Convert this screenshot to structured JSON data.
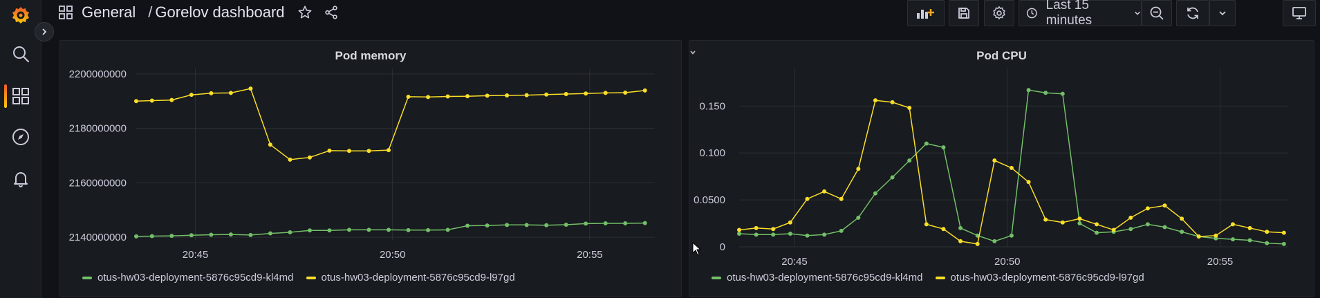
{
  "header": {
    "folder": "General",
    "dashboard": "Gorelov dashboard",
    "separator": "/",
    "time_range": "Last 15 minutes"
  },
  "colors": {
    "green": "#73bf69",
    "yellow": "#fade2a",
    "grid": "#2c2f35",
    "accent": "#f05a28"
  },
  "icons": {
    "logo": "grafana-logo-icon",
    "search": "search-icon",
    "dashboards": "dashboards-icon",
    "explore": "compass-icon",
    "alerting": "bell-icon"
  },
  "chart_data": [
    {
      "type": "line",
      "title": "Pod memory",
      "x_ticks": [
        "20:45",
        "20:50",
        "20:55"
      ],
      "y_ticks": [
        "2140000000",
        "2160000000",
        "2180000000",
        "2200000000"
      ],
      "x_range_minutes": [
        43.5,
        56.65
      ],
      "ylim": [
        2139000000,
        2202000000
      ],
      "grid": true,
      "legend": "bottom-left",
      "series": [
        {
          "name": "otus-hw03-deployment-5876c95cd9-kl4md",
          "color": "#73bf69",
          "x": [
            43.5,
            43.9,
            44.4,
            44.9,
            45.4,
            45.9,
            46.4,
            46.9,
            47.4,
            47.9,
            48.4,
            48.9,
            49.4,
            49.9,
            50.4,
            50.9,
            51.4,
            51.9,
            52.4,
            52.9,
            53.4,
            53.9,
            54.4,
            54.9,
            55.4,
            55.9,
            56.4
          ],
          "y": [
            2140300000,
            2140400000,
            2140500000,
            2140700000,
            2140900000,
            2141000000,
            2140800000,
            2141400000,
            2141800000,
            2142500000,
            2142500000,
            2142700000,
            2142700000,
            2142700000,
            2142600000,
            2142600000,
            2142700000,
            2144200000,
            2144300000,
            2144500000,
            2144500000,
            2144400000,
            2144600000,
            2145000000,
            2145100000,
            2145100000,
            2145200000
          ]
        },
        {
          "name": "otus-hw03-deployment-5876c95cd9-l97gd",
          "color": "#fade2a",
          "x": [
            43.5,
            43.9,
            44.4,
            44.9,
            45.4,
            45.9,
            46.4,
            46.9,
            47.4,
            47.9,
            48.4,
            48.9,
            49.4,
            49.9,
            50.4,
            50.9,
            51.4,
            51.9,
            52.4,
            52.9,
            53.4,
            53.9,
            54.4,
            54.9,
            55.4,
            55.9,
            56.4
          ],
          "y": [
            2190000000,
            2190200000,
            2190400000,
            2192300000,
            2192900000,
            2193000000,
            2194600000,
            2174000000,
            2168500000,
            2169300000,
            2171800000,
            2171700000,
            2171700000,
            2172000000,
            2191600000,
            2191500000,
            2191700000,
            2191800000,
            2192000000,
            2192100000,
            2192200000,
            2192400000,
            2192600000,
            2192800000,
            2193000000,
            2193100000,
            2193900000
          ]
        }
      ]
    },
    {
      "type": "line",
      "title": "Pod CPU",
      "x_ticks": [
        "20:45",
        "20:50",
        "20:55"
      ],
      "y_ticks": [
        "0",
        "0.0500",
        "0.100",
        "0.150"
      ],
      "x_range_minutes": [
        43.7,
        56.6
      ],
      "ylim": [
        0,
        0.19
      ],
      "grid": true,
      "legend": "bottom-left",
      "series": [
        {
          "name": "otus-hw03-deployment-5876c95cd9-kl4md",
          "color": "#73bf69",
          "x": [
            43.7,
            44.1,
            44.5,
            44.9,
            45.3,
            45.7,
            46.1,
            46.5,
            46.9,
            47.3,
            47.7,
            48.1,
            48.5,
            48.9,
            49.3,
            49.7,
            50.1,
            50.5,
            50.9,
            51.3,
            51.7,
            52.1,
            52.5,
            52.9,
            53.3,
            53.7,
            54.1,
            54.5,
            54.9,
            55.3,
            55.7,
            56.1,
            56.5
          ],
          "y": [
            0.014,
            0.013,
            0.013,
            0.014,
            0.012,
            0.013,
            0.017,
            0.031,
            0.057,
            0.074,
            0.092,
            0.11,
            0.106,
            0.02,
            0.012,
            0.006,
            0.012,
            0.167,
            0.164,
            0.163,
            0.025,
            0.015,
            0.016,
            0.019,
            0.024,
            0.021,
            0.016,
            0.011,
            0.009,
            0.008,
            0.007,
            0.004,
            0.003
          ],
          "xfix": null
        },
        {
          "name": "otus-hw03-deployment-5876c95cd9-l97gd",
          "color": "#fade2a",
          "x": [
            43.7,
            44.1,
            44.5,
            44.9,
            45.3,
            45.7,
            46.1,
            46.5,
            46.9,
            47.3,
            47.7,
            48.1,
            48.5,
            48.9,
            49.3,
            49.7,
            50.1,
            50.5,
            50.9,
            51.3,
            51.7,
            52.1,
            52.5,
            52.9,
            53.3,
            53.7,
            54.1,
            54.5,
            54.9,
            55.3,
            55.7,
            56.1,
            56.5
          ],
          "y": [
            0.018,
            0.02,
            0.019,
            0.026,
            0.051,
            0.059,
            0.051,
            0.083,
            0.156,
            0.154,
            0.148,
            0.024,
            0.019,
            0.006,
            0.003,
            0.092,
            0.084,
            0.069,
            0.029,
            0.026,
            0.03,
            0.024,
            0.018,
            0.031,
            0.041,
            0.044,
            0.03,
            0.011,
            0.012,
            0.024,
            0.02,
            0.016,
            0.015
          ]
        }
      ]
    }
  ]
}
